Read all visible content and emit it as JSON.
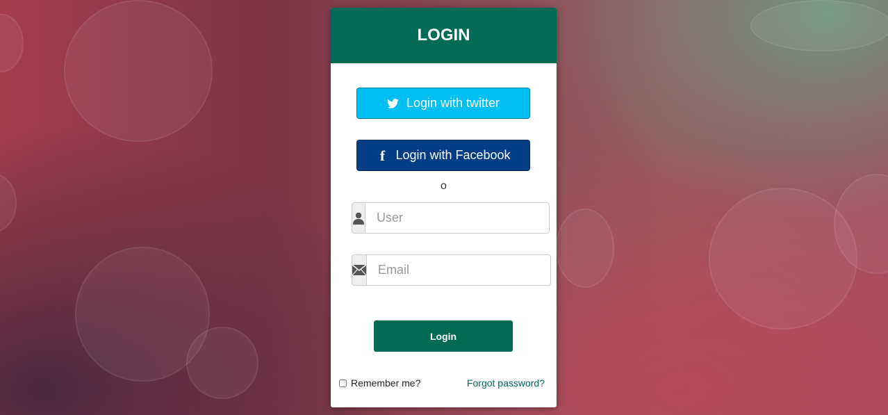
{
  "header": {
    "title": "LOGIN"
  },
  "social": {
    "twitter_label": "Login with twitter",
    "facebook_label": "Login with Facebook",
    "twitter_icon": "twitter-icon",
    "facebook_icon": "facebook-icon"
  },
  "divider": {
    "text": "o"
  },
  "fields": {
    "user": {
      "placeholder": "User",
      "value": "",
      "icon": "user-icon"
    },
    "email": {
      "placeholder": "Email",
      "value": "",
      "icon": "envelope-icon"
    }
  },
  "actions": {
    "login_label": "Login"
  },
  "footer": {
    "remember_label": "Remember me?",
    "forgot_label": "Forgot password?"
  },
  "colors": {
    "header": "#006a55",
    "twitter": "#00bff3",
    "facebook": "#033d85",
    "login_button": "#006a55",
    "link": "#006a55"
  }
}
